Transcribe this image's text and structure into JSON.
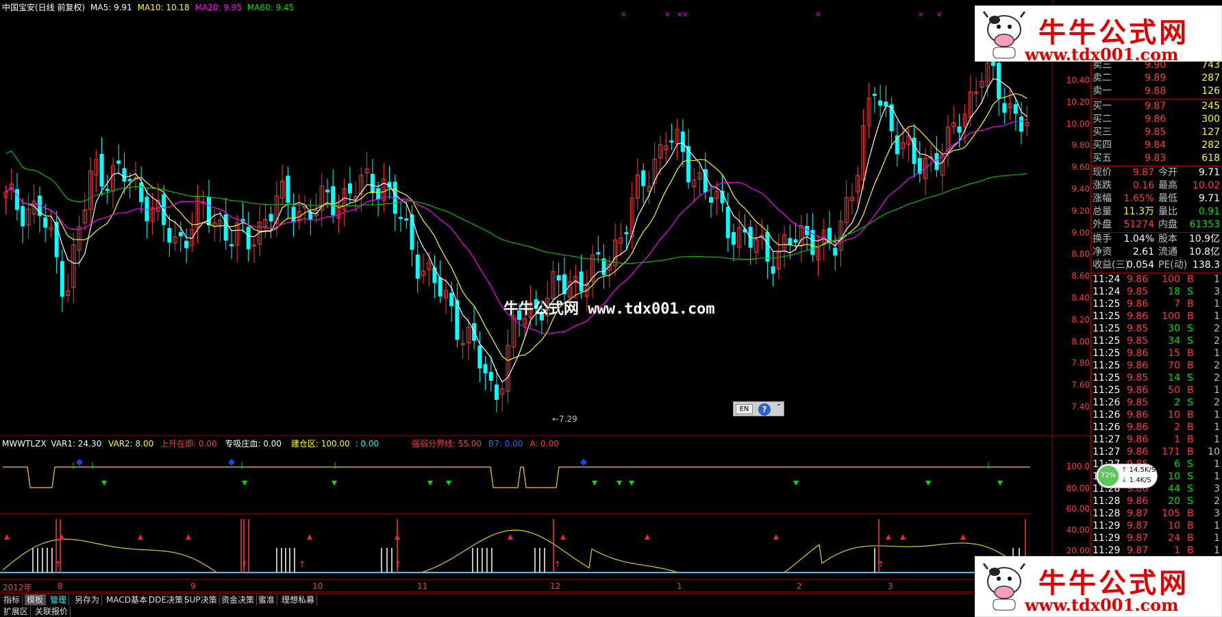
{
  "title_bar": {
    "stock": "中国宝安(日线 前复权)",
    "ma5": "MA5: 9.91",
    "ma10": "MA10: 10.18",
    "ma20": "MA20: 9.95",
    "ma60": "MA60: 9.45"
  },
  "price_axis": [
    "10.40",
    "10.20",
    "10.00",
    "9.80",
    "9.60",
    "9.40",
    "9.20",
    "9.00",
    "8.80",
    "8.60",
    "8.40",
    "8.20",
    "8.00",
    "7.80",
    "7.60",
    "7.40"
  ],
  "low_marker": "←7.29",
  "watermark_center": "牛牛公式网 www.tdx001.com",
  "ime_widget": {
    "lang": "EN",
    "help": "?"
  },
  "indicator_header": {
    "name": "MWWTLZX",
    "var1": "VAR1: 24.30",
    "var2": "VAR2: 8.00",
    "shangsheng": "上升在即: 0.00",
    "zhuangxue": "专吸庄血: 0.00",
    "jiancang": "建仓区: 100.00",
    "jiancang2": ": 0.00",
    "qiangruo": "强弱分界线: 55.00",
    "b7": "B7: 0.00",
    "a": "A: 0.00"
  },
  "indicator_axis_1": [
    "100.0",
    "80.00"
  ],
  "indicator_axis_2": [
    "60.00",
    "40.00",
    "20.00"
  ],
  "date_axis": [
    "2012年",
    "8",
    "9",
    "10",
    "11",
    "12",
    "1",
    "2",
    "3"
  ],
  "quote": {
    "asks": [
      {
        "label": "卖三",
        "price": "9.90",
        "vol": "743"
      },
      {
        "label": "卖二",
        "price": "9.89",
        "vol": "287"
      },
      {
        "label": "卖一",
        "price": "9.88",
        "vol": "126"
      }
    ],
    "bids": [
      {
        "label": "买一",
        "price": "9.87",
        "vol": "245"
      },
      {
        "label": "买二",
        "price": "9.86",
        "vol": "300"
      },
      {
        "label": "买三",
        "price": "9.85",
        "vol": "127"
      },
      {
        "label": "买四",
        "price": "9.84",
        "vol": "282"
      },
      {
        "label": "买五",
        "price": "9.83",
        "vol": "618"
      }
    ],
    "stats": [
      {
        "l1": "现价",
        "v1": "9.87",
        "l2": "今开",
        "v2": "9.71"
      },
      {
        "l1": "涨跌",
        "v1": "0.16",
        "l2": "最高",
        "v2": "10.02"
      },
      {
        "l1": "涨幅",
        "v1": "1.65%",
        "l2": "最低",
        "v2": "9.71"
      },
      {
        "l1": "总量",
        "v1": "11.3万",
        "l2": "量比",
        "v2": "0.91"
      },
      {
        "l1": "外盘",
        "v1": "51274",
        "l2": "内盘",
        "v2": "61353"
      }
    ],
    "stats2": [
      {
        "l1": "换手",
        "v1": "1.04%",
        "l2": "股本",
        "v2": "10.9亿"
      },
      {
        "l1": "净资",
        "v1": "2.61",
        "l2": "流通",
        "v2": "10.8亿"
      },
      {
        "l1": "收益(三)",
        "v1": "0.054",
        "l2": "PE(动)",
        "v2": "138.3"
      }
    ],
    "ticks": [
      {
        "t": "11:24",
        "p": "9.86",
        "v": "100",
        "d": "B",
        "n": "1"
      },
      {
        "t": "11:24",
        "p": "9.85",
        "v": "18",
        "d": "S",
        "n": "3"
      },
      {
        "t": "11:25",
        "p": "9.86",
        "v": "7",
        "d": "B",
        "n": "1"
      },
      {
        "t": "11:25",
        "p": "9.86",
        "v": "100",
        "d": "B",
        "n": "1"
      },
      {
        "t": "11:25",
        "p": "9.85",
        "v": "30",
        "d": "S",
        "n": "2"
      },
      {
        "t": "11:25",
        "p": "9.85",
        "v": "34",
        "d": "S",
        "n": "2"
      },
      {
        "t": "11:25",
        "p": "9.86",
        "v": "15",
        "d": "B",
        "n": "1"
      },
      {
        "t": "11:25",
        "p": "9.86",
        "v": "70",
        "d": "B",
        "n": "2"
      },
      {
        "t": "11:25",
        "p": "9.85",
        "v": "14",
        "d": "S",
        "n": "2"
      },
      {
        "t": "11:25",
        "p": "9.86",
        "v": "50",
        "d": "B",
        "n": "1"
      },
      {
        "t": "11:26",
        "p": "9.85",
        "v": "2",
        "d": "S",
        "n": "2"
      },
      {
        "t": "11:26",
        "p": "9.86",
        "v": "10",
        "d": "B",
        "n": "1"
      },
      {
        "t": "11:26",
        "p": "9.86",
        "v": "2",
        "d": "B",
        "n": "1"
      },
      {
        "t": "11:27",
        "p": "9.86",
        "v": "1",
        "d": "B",
        "n": "1"
      },
      {
        "t": "11:27",
        "p": "9.86",
        "v": "171",
        "d": "B",
        "n": "10"
      },
      {
        "t": "11:27",
        "p": "9.85",
        "v": "6",
        "d": "S",
        "n": "1"
      },
      {
        "t": "11:27",
        "p": "9.85",
        "v": "10",
        "d": "S",
        "n": "1"
      },
      {
        "t": "11:28",
        "p": "9.86",
        "v": "44",
        "d": "S",
        "n": "3"
      },
      {
        "t": "11:28",
        "p": "9.86",
        "v": "20",
        "d": "S",
        "n": "2"
      },
      {
        "t": "11:28",
        "p": "9.87",
        "v": "105",
        "d": "B",
        "n": "3"
      },
      {
        "t": "11:29",
        "p": "9.87",
        "v": "10",
        "d": "B",
        "n": "1"
      },
      {
        "t": "11:29",
        "p": "9.87",
        "v": "24",
        "d": "B",
        "n": "1"
      },
      {
        "t": "11:29",
        "p": "9.87",
        "v": "1",
        "d": "B",
        "n": "1"
      }
    ]
  },
  "net_widget": {
    "percent": "72%",
    "up": "14.5K/S",
    "down": "1.4K/S"
  },
  "toolbar": [
    "指标",
    "模板",
    "管理",
    "另存为",
    "MACD基本",
    "DDE决策",
    "SUP决策",
    "资金决策",
    "蜜准",
    "理想私募"
  ],
  "bottom_bar": [
    "扩展区",
    "关联报价"
  ],
  "logo": {
    "cn": "牛牛公式网",
    "url": "www.tdx001.com"
  },
  "colors": {
    "up": "#ff3b3b",
    "down": "#00ffff",
    "ma5": "#ffffff",
    "ma10": "#ffff00",
    "ma20": "#ff00ff",
    "ma60": "#00c000"
  }
}
